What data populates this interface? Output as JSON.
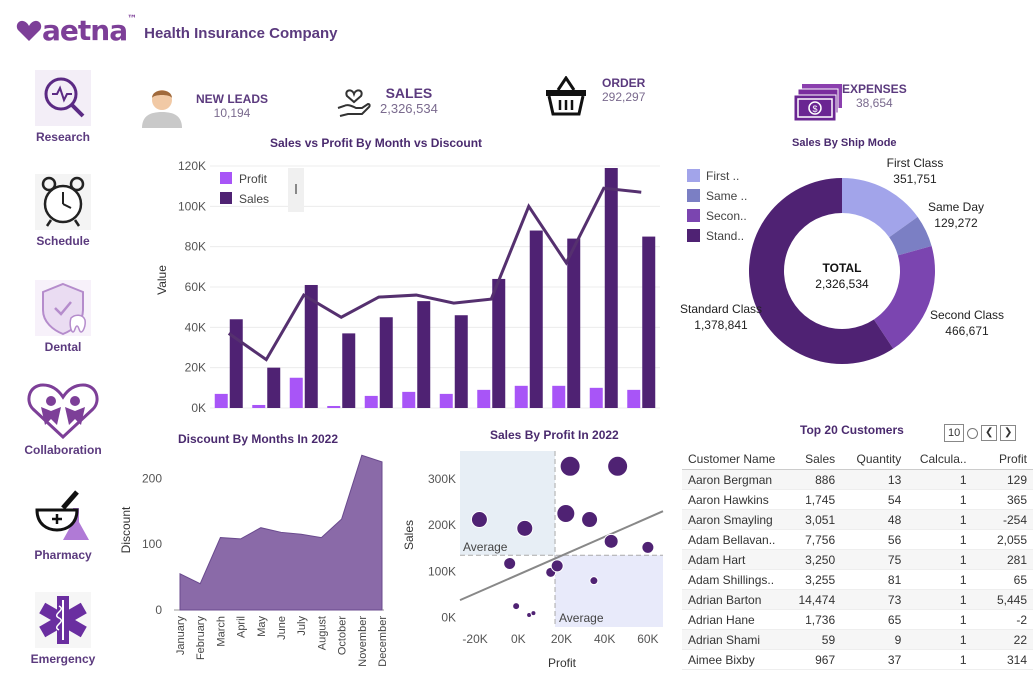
{
  "header": {
    "brand": "aetna",
    "brand_tm": "™",
    "subtitle": "Health Insurance Company"
  },
  "nav": [
    {
      "label": "Research",
      "icon": "research-icon"
    },
    {
      "label": "Schedule",
      "icon": "alarm-clock-icon"
    },
    {
      "label": "Dental",
      "icon": "dental-icon"
    },
    {
      "label": "Collaboration",
      "icon": "collaboration-icon"
    },
    {
      "label": "Pharmacy",
      "icon": "pharmacy-icon"
    },
    {
      "label": "Emergency",
      "icon": "emergency-icon"
    }
  ],
  "kpis": {
    "leads": {
      "title": "NEW LEADS",
      "value": "10,194",
      "icon": "person-icon"
    },
    "sales": {
      "title": "SALES",
      "value": "2,326,534",
      "icon": "hand-heart-icon"
    },
    "order": {
      "title": "ORDER",
      "value": "292,297",
      "icon": "basket-icon"
    },
    "expenses": {
      "title": "EXPENSES",
      "value": "38,654",
      "icon": "money-icon"
    }
  },
  "colors": {
    "dark": "#4f2273",
    "light": "#a855f7",
    "area": "#8a6aa8",
    "lavender": "#a2a4ea",
    "slate": "#7b7fc4",
    "mid": "#7b45b0"
  },
  "chart_data": [
    {
      "type": "bar",
      "title": "Sales vs Profit By Month vs Discount",
      "ylabel": "Value",
      "ylim": [
        0,
        120000
      ],
      "yticks": [
        "0K",
        "20K",
        "40K",
        "60K",
        "80K",
        "100K",
        "120K"
      ],
      "series": [
        {
          "name": "Profit",
          "values": [
            7000,
            1500,
            15000,
            1000,
            6000,
            8000,
            7000,
            9000,
            11000,
            11000,
            10000,
            9000
          ]
        },
        {
          "name": "Sales",
          "values": [
            44000,
            20000,
            61000,
            37000,
            45000,
            53000,
            46000,
            64000,
            88000,
            84000,
            119000,
            85000
          ]
        }
      ],
      "line_values": [
        37000,
        24000,
        56000,
        45000,
        55000,
        56000,
        52000,
        54000,
        100000,
        72000,
        109000,
        107000
      ],
      "legend": "top-left"
    },
    {
      "type": "pie",
      "title": "Sales By Ship Mode",
      "center_label": "TOTAL",
      "center_value": "2,326,534",
      "legend": [
        "First ..",
        "Same ..",
        "Secon..",
        "Stand.."
      ],
      "slices": [
        {
          "name": "First Class",
          "value": 351751,
          "label": "351,751"
        },
        {
          "name": "Same Day",
          "value": 129272,
          "label": "129,272"
        },
        {
          "name": "Second Class",
          "value": 466671,
          "label": "466,671"
        },
        {
          "name": "Standard Class",
          "value": 1378841,
          "label": "1,378,841"
        }
      ]
    },
    {
      "type": "area",
      "title": "Discount By Months In 2022",
      "ylabel": "Discount",
      "ylim": [
        0,
        240
      ],
      "yticks": [
        "0",
        "100",
        "200"
      ],
      "categories": [
        "January",
        "February",
        "March",
        "April",
        "May",
        "June",
        "July",
        "August",
        "October",
        "November",
        "December"
      ],
      "values": [
        55,
        40,
        110,
        108,
        125,
        118,
        115,
        110,
        138,
        235,
        225
      ]
    },
    {
      "type": "scatter",
      "title": "Sales By Profit In 2022",
      "xlabel": "Profit",
      "ylabel": "Sales",
      "xlim": [
        -27000,
        67000
      ],
      "ylim": [
        -20000,
        360000
      ],
      "xticks": [
        "-20K",
        "0K",
        "20K",
        "40K",
        "60K"
      ],
      "yticks": [
        "0K",
        "100K",
        "200K",
        "300K"
      ],
      "avg_x": 17000,
      "avg_y": 135000,
      "avg_label": "Average",
      "points": [
        {
          "x": -18000,
          "y": 212000,
          "r": 8
        },
        {
          "x": 3000,
          "y": 193000,
          "r": 8
        },
        {
          "x": -4000,
          "y": 117000,
          "r": 6
        },
        {
          "x": -1000,
          "y": 25000,
          "r": 3.5
        },
        {
          "x": 5000,
          "y": 6000,
          "r": 2.5
        },
        {
          "x": 7000,
          "y": 10000,
          "r": 2.5
        },
        {
          "x": 15000,
          "y": 98000,
          "r": 5
        },
        {
          "x": 18000,
          "y": 112000,
          "r": 6
        },
        {
          "x": 22000,
          "y": 225000,
          "r": 9
        },
        {
          "x": 24000,
          "y": 327000,
          "r": 10
        },
        {
          "x": 33000,
          "y": 212000,
          "r": 8
        },
        {
          "x": 35000,
          "y": 80000,
          "r": 4
        },
        {
          "x": 46000,
          "y": 327000,
          "r": 10
        },
        {
          "x": 43000,
          "y": 165000,
          "r": 7
        },
        {
          "x": 60000,
          "y": 152000,
          "r": 6
        }
      ],
      "trend": [
        [
          -27000,
          38000
        ],
        [
          67000,
          230000
        ]
      ]
    },
    {
      "type": "table",
      "title": "Top 20 Customers",
      "page": "10",
      "columns": [
        "Customer Name",
        "Sales",
        "Quantity",
        "Calcula..",
        "Profit"
      ],
      "rows": [
        [
          "Aaron Bergman",
          "886",
          "13",
          "1",
          "129"
        ],
        [
          "Aaron Hawkins",
          "1,745",
          "54",
          "1",
          "365"
        ],
        [
          "Aaron Smayling",
          "3,051",
          "48",
          "1",
          "-254"
        ],
        [
          "Adam Bellavan..",
          "7,756",
          "56",
          "1",
          "2,055"
        ],
        [
          "Adam Hart",
          "3,250",
          "75",
          "1",
          "281"
        ],
        [
          "Adam Shillings..",
          "3,255",
          "81",
          "1",
          "65"
        ],
        [
          "Adrian Barton",
          "14,474",
          "73",
          "1",
          "5,445"
        ],
        [
          "Adrian Hane",
          "1,736",
          "65",
          "1",
          "-2"
        ],
        [
          "Adrian Shami",
          "59",
          "9",
          "1",
          "22"
        ],
        [
          "Aimee Bixby",
          "967",
          "37",
          "1",
          "314"
        ]
      ]
    }
  ]
}
